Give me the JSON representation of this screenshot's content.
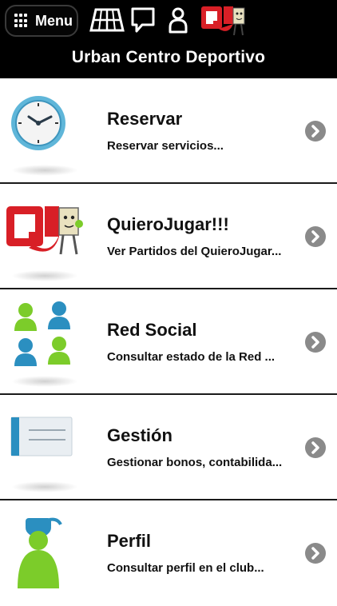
{
  "header": {
    "menu_label": "Menu",
    "title": "Urban Centro Deportivo",
    "icons": [
      "court-icon",
      "chat-bubble-icon",
      "user-icon",
      "quierojugar-logo-icon"
    ]
  },
  "items": [
    {
      "title": "Reservar",
      "subtitle": "Reservar servicios...",
      "icon": "clock-icon"
    },
    {
      "title": "QuieroJugar!!!",
      "subtitle": "Ver Partidos del QuieroJugar...",
      "icon": "quierojugar-logo-icon"
    },
    {
      "title": "Red Social",
      "subtitle": "Consultar estado de la Red ...",
      "icon": "people-group-icon"
    },
    {
      "title": "Gestión",
      "subtitle": "Gestionar bonos, contabilida...",
      "icon": "card-icon"
    },
    {
      "title": "Perfil",
      "subtitle": "Consultar perfil en el club...",
      "icon": "profile-icon"
    }
  ],
  "colors": {
    "header_bg": "#000000",
    "accent_blue": "#2b8fc0",
    "accent_green": "#7ccc2a",
    "logo_red": "#d81f26",
    "chevron": "#8a8a8a"
  }
}
